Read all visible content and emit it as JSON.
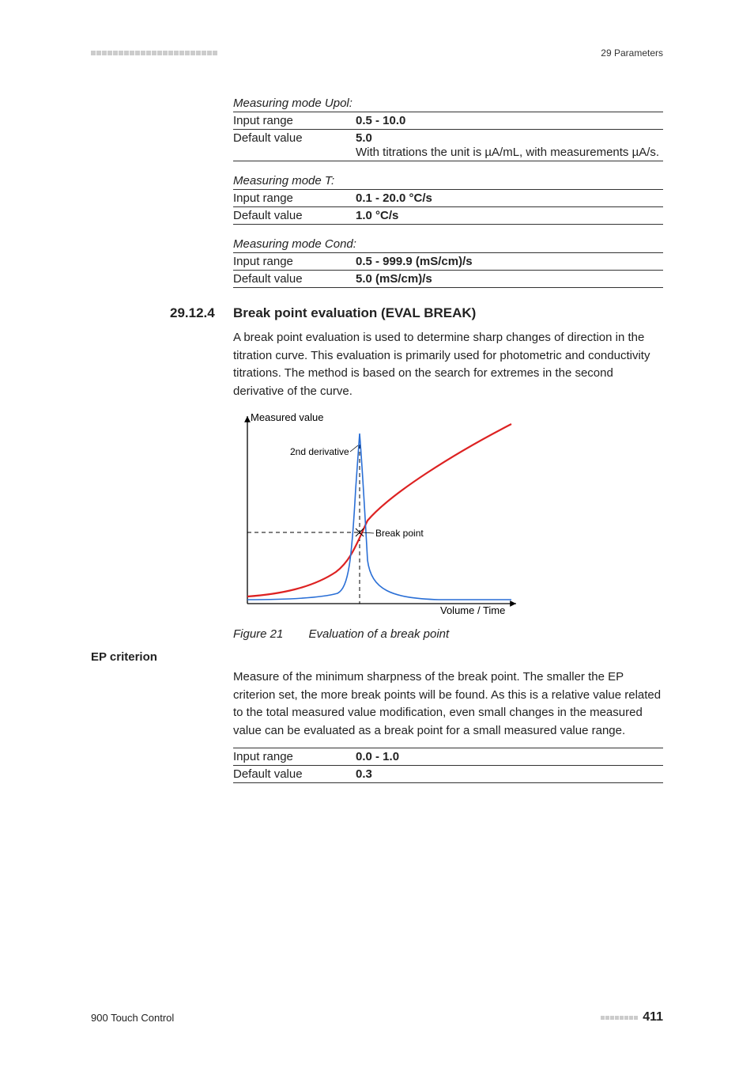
{
  "header": {
    "crumb": "29 Parameters"
  },
  "groups": [
    {
      "heading": "Measuring mode Upol:",
      "rows": [
        {
          "label": "Input range",
          "value": "0.5 - 10.0",
          "note": ""
        },
        {
          "label": "Default value",
          "value": "5.0",
          "note": "With titrations the unit is µA/mL, with measurements µA/s."
        }
      ]
    },
    {
      "heading": "Measuring mode T:",
      "rows": [
        {
          "label": "Input range",
          "value": "0.1 - 20.0 °C/s",
          "note": ""
        },
        {
          "label": "Default value",
          "value": "1.0 °C/s",
          "note": ""
        }
      ]
    },
    {
      "heading": "Measuring mode Cond:",
      "rows": [
        {
          "label": "Input range",
          "value": "0.5 - 999.9 (mS/cm)/s",
          "note": ""
        },
        {
          "label": "Default value",
          "value": "5.0 (mS/cm)/s",
          "note": ""
        }
      ]
    }
  ],
  "section": {
    "number": "29.12.4",
    "title": "Break point evaluation (EVAL BREAK)",
    "intro": "A break point evaluation is used to determine sharp changes of direction in the titration curve. This evaluation is primarily used for photometric and conductivity titrations. The method is based on the search for extremes in the second derivative of the curve."
  },
  "chart": {
    "y_label": "Measured value",
    "x_label": "Volume / Time",
    "series1_label": "2nd derivative",
    "point_label": "Break point",
    "caption_label": "Figure 21",
    "caption_text": "Evaluation of a break point"
  },
  "chart_data": {
    "type": "line",
    "title": "Evaluation of a break point",
    "xlabel": "Volume / Time",
    "ylabel": "Measured value",
    "series": [
      {
        "name": "Measured value",
        "color": "#d22",
        "x": [
          0,
          0.1,
          0.2,
          0.3,
          0.36,
          0.4,
          0.44,
          0.5,
          0.65,
          0.8,
          1.0
        ],
        "y": [
          0.04,
          0.06,
          0.1,
          0.2,
          0.34,
          0.44,
          0.54,
          0.62,
          0.74,
          0.84,
          0.98
        ]
      },
      {
        "name": "2nd derivative",
        "color": "#2a6fd6",
        "x": [
          0,
          0.15,
          0.25,
          0.32,
          0.36,
          0.4,
          0.44,
          0.48,
          0.55,
          0.7,
          1.0
        ],
        "y": [
          0.02,
          0.02,
          0.04,
          0.12,
          0.4,
          0.92,
          0.4,
          0.12,
          0.04,
          0.02,
          0.02
        ]
      }
    ],
    "annotations": [
      {
        "text": "Break point",
        "x": 0.4,
        "y": 0.44
      }
    ],
    "xlim": [
      0,
      1
    ],
    "ylim": [
      0,
      1
    ]
  },
  "ep": {
    "heading": "EP criterion",
    "body": "Measure of the minimum sharpness of the break point. The smaller the EP criterion set, the more break points will be found. As this is a relative value related to the total measured value modification, even small changes in the measured value can be evaluated as a break point for a small measured value range.",
    "rows": [
      {
        "label": "Input range",
        "value": "0.0 - 1.0"
      },
      {
        "label": "Default value",
        "value": "0.3"
      }
    ]
  },
  "footer": {
    "product": "900 Touch Control",
    "page": "411"
  }
}
